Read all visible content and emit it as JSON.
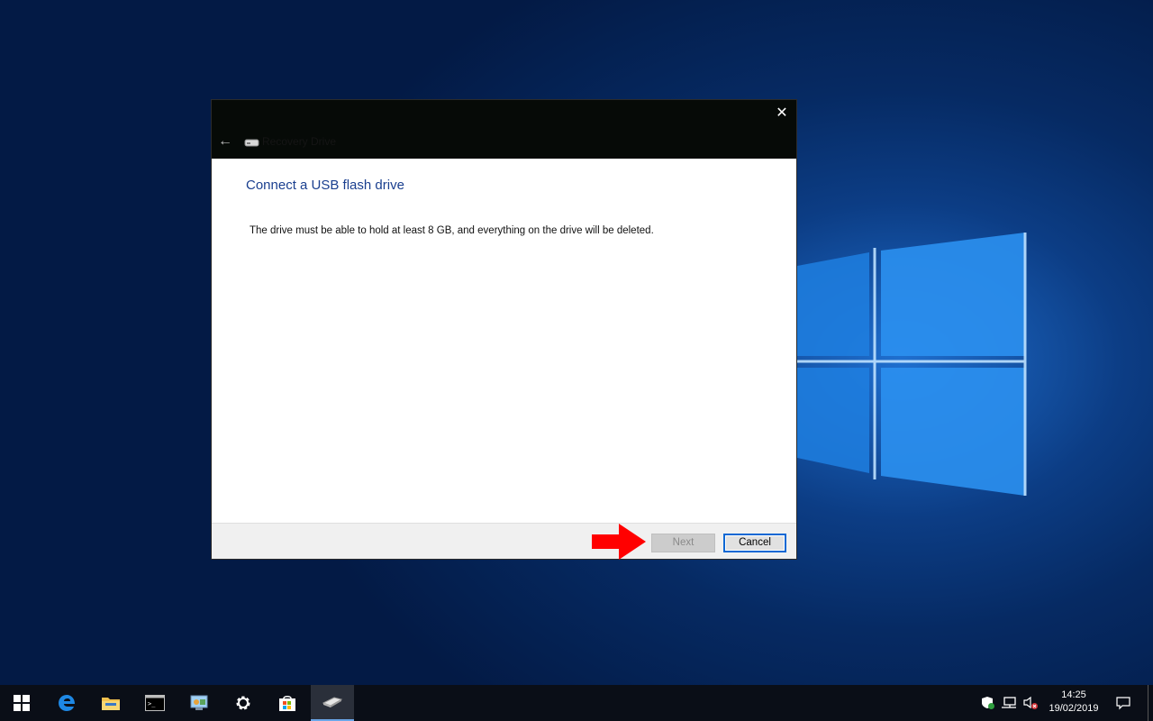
{
  "dialog": {
    "title": "Recovery Drive",
    "heading": "Connect a USB flash drive",
    "body": "The drive must be able to hold at least 8 GB, and everything on the drive will be deleted.",
    "close_glyph": "✕",
    "back_glyph": "←",
    "next_label": "Next",
    "cancel_label": "Cancel",
    "next_enabled": false
  },
  "taskbar": {
    "items": [
      {
        "icon": "windows-start-icon"
      },
      {
        "icon": "edge-browser-icon"
      },
      {
        "icon": "file-explorer-icon"
      },
      {
        "icon": "command-prompt-icon"
      },
      {
        "icon": "control-panel-icon"
      },
      {
        "icon": "settings-gear-icon"
      },
      {
        "icon": "store-icon"
      },
      {
        "icon": "recovery-drive-icon"
      }
    ],
    "time": "14:25",
    "date": "19/02/2019"
  },
  "colors": {
    "heading": "#1a3f8f",
    "titlebar": "#060a07",
    "accent": "#0b68d4",
    "annotation_arrow": "#ff0000"
  }
}
